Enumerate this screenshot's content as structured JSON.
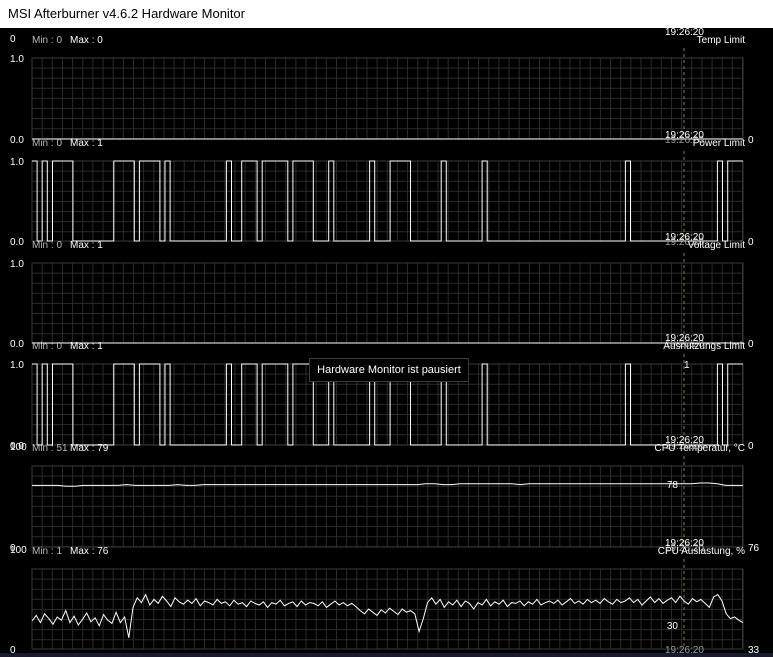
{
  "window": {
    "title": "MSI Afterburner v4.6.2 Hardware Monitor"
  },
  "status": {
    "paused_text": "Hardware Monitor ist pausiert"
  },
  "colors": {
    "background": "#000000",
    "grid": "#2b2b2b",
    "line": "#ffffff",
    "text": "#ffffff",
    "label_dim": "#b9b9b9"
  },
  "graphs": [
    {
      "id": "temp-limit",
      "name": "Temp Limit",
      "min_text": "Min : 0",
      "max_text": "Max : 0",
      "ytop": "0",
      "ytop2": "1.0",
      "ybottom": "0.0",
      "time": "19:26:20",
      "current": "0",
      "series": [
        0,
        0
      ]
    },
    {
      "id": "power-limit",
      "name": "Power Limit",
      "min_text": "Min : 0",
      "max_text": "Max : 1",
      "ytop": "",
      "ytop2": "1.0",
      "ybottom": "0.0",
      "time": "19:26:20",
      "current": "0",
      "series_type": "binary",
      "series": [
        1,
        0,
        1,
        0,
        1,
        1,
        1,
        1,
        0,
        0,
        0,
        0,
        0,
        0,
        0,
        0,
        1,
        1,
        1,
        1,
        0,
        1,
        1,
        1,
        1,
        0,
        1,
        0,
        0,
        0,
        0,
        0,
        0,
        0,
        0,
        0,
        0,
        0,
        1,
        0,
        0,
        1,
        1,
        1,
        0,
        1,
        1,
        1,
        1,
        1,
        0,
        1,
        1,
        1,
        1,
        0,
        0,
        0,
        1,
        0,
        0,
        0,
        0,
        0,
        0,
        0,
        1,
        0,
        0,
        0,
        1,
        1,
        1,
        1,
        0,
        0,
        0,
        0,
        0,
        0,
        1,
        0,
        0,
        0,
        0,
        0,
        0,
        0,
        1,
        0,
        0,
        0,
        0,
        0,
        0,
        0,
        0,
        0,
        0,
        0,
        0,
        0,
        0,
        0,
        0,
        0,
        0,
        0,
        0,
        0,
        0,
        0,
        0,
        0,
        0,
        0,
        1,
        0,
        0,
        0,
        0,
        0,
        0,
        0,
        0,
        0,
        0,
        0,
        0,
        0,
        0,
        0,
        0,
        0,
        1,
        0,
        1,
        1,
        1,
        1
      ]
    },
    {
      "id": "voltage-limit",
      "name": "Voltage Limit",
      "min_text": "Min : 0",
      "max_text": "Max : 1",
      "ytop": "",
      "ytop2": "1.0",
      "ybottom": "0.0",
      "time": "19:26:20",
      "current": "0",
      "series": [
        0,
        0
      ]
    },
    {
      "id": "util-limit",
      "name": "Ausnutzungs Limit",
      "min_text": "Min : 0",
      "max_text": "Max : 1",
      "ytop": "",
      "ytop2": "1.0",
      "ybottom": "0.0",
      "time": "19:26:20",
      "current": "0",
      "marker": "1",
      "series_type": "binary",
      "series": [
        1,
        0,
        1,
        0,
        1,
        1,
        1,
        1,
        0,
        0,
        0,
        0,
        0,
        0,
        0,
        0,
        1,
        1,
        1,
        1,
        0,
        1,
        1,
        1,
        1,
        0,
        1,
        0,
        0,
        0,
        0,
        0,
        0,
        0,
        0,
        0,
        0,
        0,
        1,
        0,
        0,
        1,
        1,
        1,
        0,
        1,
        1,
        1,
        1,
        1,
        0,
        1,
        1,
        1,
        1,
        0,
        0,
        0,
        1,
        0,
        0,
        0,
        0,
        0,
        0,
        0,
        1,
        0,
        0,
        0,
        1,
        1,
        1,
        1,
        0,
        0,
        0,
        0,
        0,
        0,
        1,
        0,
        0,
        0,
        0,
        0,
        0,
        0,
        1,
        0,
        0,
        0,
        0,
        0,
        0,
        0,
        0,
        0,
        0,
        0,
        0,
        0,
        0,
        0,
        0,
        0,
        0,
        0,
        0,
        0,
        0,
        0,
        0,
        0,
        0,
        0,
        1,
        0,
        0,
        0,
        0,
        0,
        0,
        0,
        0,
        0,
        0,
        0,
        0,
        0,
        0,
        0,
        0,
        0,
        1,
        0,
        1,
        1,
        1,
        1
      ]
    },
    {
      "id": "cpu-temp",
      "name": "CPU Temperatur, °C",
      "min_text": "Min : 51",
      "max_text": "Max : 79",
      "ytop": "100",
      "ybottom": "0",
      "time": "19:26:20",
      "current": "76",
      "cursor_value": "78",
      "ymax": 100,
      "series": [
        76,
        76,
        76,
        76,
        75,
        75,
        76,
        76,
        76,
        76,
        76,
        77,
        76,
        76,
        76,
        76,
        76,
        77,
        76,
        76,
        77,
        77,
        77,
        77,
        77,
        77,
        77,
        77,
        77,
        77,
        77,
        77,
        77,
        77,
        77,
        77,
        77,
        77,
        77,
        77,
        77,
        77,
        77,
        77,
        77,
        77,
        78,
        78,
        77,
        77,
        78,
        78,
        78,
        78,
        78,
        78,
        78,
        77,
        78,
        78,
        78,
        78,
        78,
        78,
        78,
        78,
        78,
        78,
        78,
        78,
        78,
        78,
        78,
        78,
        78,
        78,
        78,
        78,
        79,
        79,
        78,
        76,
        76,
        76
      ]
    },
    {
      "id": "cpu-load",
      "name": "CPU Auslastung, %",
      "min_text": "Min : 1",
      "max_text": "Max : 76",
      "ytop": "100",
      "ybottom": "0",
      "time": "19:26:20",
      "current": "33",
      "cursor_value": "30",
      "ymax": 100,
      "series": [
        35,
        42,
        33,
        44,
        38,
        31,
        40,
        36,
        48,
        33,
        41,
        30,
        37,
        45,
        34,
        39,
        29,
        43,
        36,
        32,
        46,
        33,
        40,
        14,
        52,
        64,
        58,
        68,
        55,
        62,
        57,
        66,
        60,
        53,
        64,
        59,
        56,
        61,
        57,
        63,
        54,
        60,
        58,
        55,
        62,
        57,
        59,
        54,
        61,
        56,
        58,
        53,
        60,
        57,
        55,
        59,
        52,
        58,
        56,
        61,
        54,
        57,
        59,
        53,
        60,
        55,
        58,
        57,
        54,
        59,
        52,
        56,
        60,
        55,
        58,
        54,
        57,
        53,
        48,
        44,
        50,
        46,
        42,
        49,
        45,
        51,
        47,
        43,
        50,
        46,
        48,
        44,
        22,
        38,
        58,
        64,
        56,
        62,
        52,
        59,
        55,
        61,
        53,
        60,
        57,
        50,
        58,
        55,
        62,
        54,
        59,
        56,
        61,
        53,
        58,
        57,
        60,
        54,
        59,
        56,
        62,
        55,
        58,
        60,
        57,
        61,
        55,
        59,
        63,
        57,
        60,
        56,
        62,
        58,
        61,
        57,
        63,
        59,
        56,
        62,
        58,
        60,
        64,
        58,
        62,
        55,
        60,
        65,
        58,
        63,
        57,
        61,
        64,
        58,
        66,
        60,
        56,
        63,
        59,
        62,
        57,
        52,
        65,
        68,
        60,
        44,
        38,
        40,
        36,
        33
      ]
    }
  ]
}
